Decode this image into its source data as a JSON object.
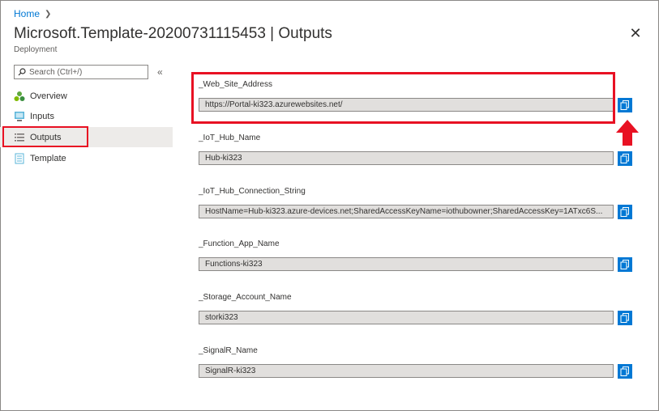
{
  "breadcrumb": {
    "home": "Home"
  },
  "header": {
    "title": "Microsoft.Template-20200731115453 | Outputs",
    "subtitle": "Deployment",
    "close_icon": "close-icon"
  },
  "search": {
    "placeholder": "Search (Ctrl+/)",
    "icon": "search-icon"
  },
  "collapse": {
    "glyph": "«"
  },
  "sidebar": {
    "items": [
      {
        "label": "Overview",
        "icon": "overview-icon"
      },
      {
        "label": "Inputs",
        "icon": "inputs-icon"
      },
      {
        "label": "Outputs",
        "icon": "outputs-icon",
        "selected": true
      },
      {
        "label": "Template",
        "icon": "template-icon"
      }
    ]
  },
  "outputs": [
    {
      "name": "_Web_Site_Address",
      "value": "https://Portal-ki323.azurewebsites.net/",
      "highlighted": true
    },
    {
      "name": "_IoT_Hub_Name",
      "value": "Hub-ki323"
    },
    {
      "name": "_IoT_Hub_Connection_String",
      "value": "HostName=Hub-ki323.azure-devices.net;SharedAccessKeyName=iothubowner;SharedAccessKey=1ATxc6S..."
    },
    {
      "name": "_Function_App_Name",
      "value": "Functions-ki323"
    },
    {
      "name": "_Storage_Account_Name",
      "value": "storki323"
    },
    {
      "name": "_SignalR_Name",
      "value": "SignalR-ki323"
    }
  ],
  "colors": {
    "accent": "#0078d4",
    "highlight": "#e81123"
  }
}
